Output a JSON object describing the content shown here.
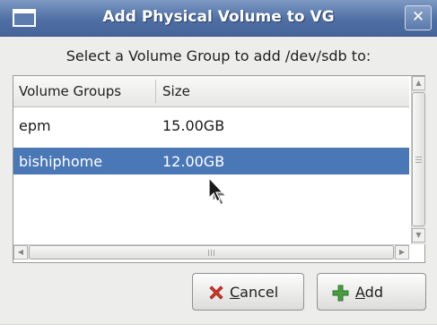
{
  "window": {
    "title": "Add Physical Volume to VG",
    "close_glyph": "✕"
  },
  "prompt": "Select a Volume Group to add /dev/sdb to:",
  "table": {
    "columns": [
      "Volume Groups",
      "Size"
    ],
    "rows": [
      {
        "name": "epm",
        "size": "15.00GB",
        "selected": false
      },
      {
        "name": "bishiphome",
        "size": "12.00GB",
        "selected": true
      }
    ]
  },
  "scrollbars": {
    "up_glyph": "▲",
    "down_glyph": "▼",
    "left_glyph": "◀",
    "right_glyph": "▶"
  },
  "buttons": {
    "cancel": {
      "mnemonic": "C",
      "rest": "ancel",
      "icon": "cancel-x-icon",
      "icon_color": "#d9352a"
    },
    "add": {
      "mnemonic": "A",
      "rest": "dd",
      "icon": "plus-icon",
      "icon_color": "#3f8f38"
    }
  },
  "colors": {
    "selection": "#4a78b7",
    "titlebar": "#4f6fa4"
  }
}
